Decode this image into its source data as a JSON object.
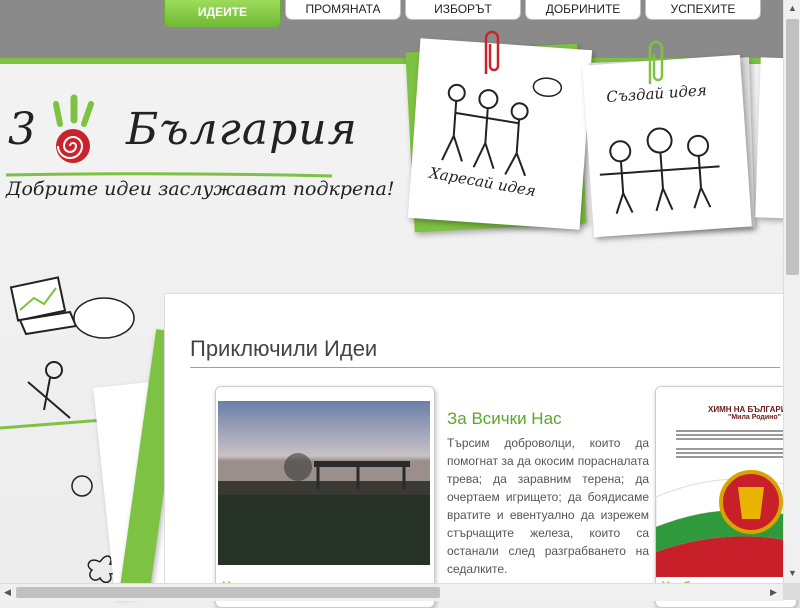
{
  "nav": {
    "items": [
      {
        "label": "ИДЕИТЕ",
        "active": true
      },
      {
        "label": "ПРОМЯНАТА",
        "active": false
      },
      {
        "label": "ИЗБОРЪТ",
        "active": false
      },
      {
        "label": "ДОБРИНИТЕ",
        "active": false
      },
      {
        "label": "УСПЕХИТЕ",
        "active": false
      }
    ]
  },
  "logo": {
    "digit": "3",
    "brand": "България",
    "tagline": "Добрите идеи заслужават подкрепа!"
  },
  "notes": {
    "like": "Харесай идея",
    "create": "Създай идея"
  },
  "main": {
    "title": "Приключили Идеи",
    "ideas": [
      {
        "title": "За Всички Нас",
        "description": "Търсим доброволци, които да помогнат за да окосим порасналата трева; да заравним терена; да очертаем игрището; да боядисаме вратите и евентуално да изрежем стърчащите железа, които са останали след разграбването на седалките.",
        "card_caption": "Нова площадка за спортни игри"
      },
      {
        "card_caption": "Учебните дни в миналото",
        "image_text_1": "ХИМН НА БЪЛГАРИЯ",
        "image_text_2": "\"Мила Родино\""
      }
    ]
  },
  "colors": {
    "accent": "#7dc242",
    "band": "#8a8a8a"
  }
}
